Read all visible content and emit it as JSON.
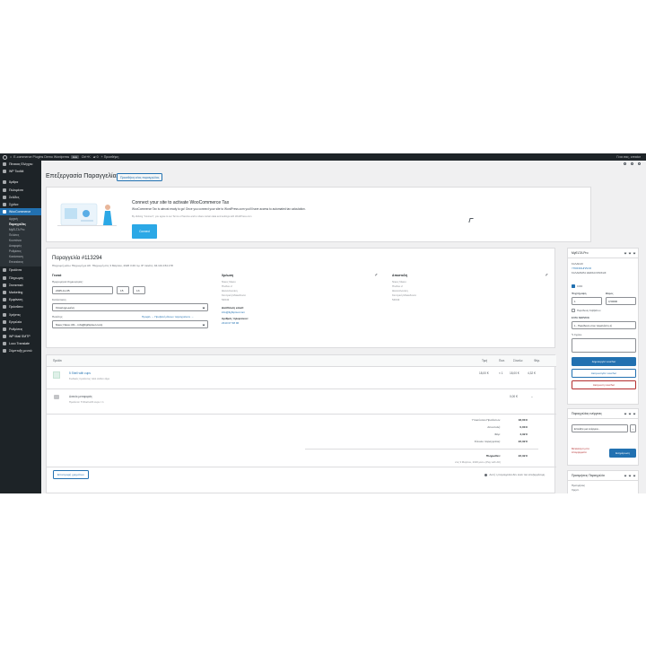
{
  "adminbar": {
    "site_name": "E-commerce Plugins Demo Wordpress",
    "site_badge": "Live",
    "comments_count": "Ctrl+K",
    "updates_count": "0",
    "new_label": "Προσθήκη",
    "greeting": "Γεια σας, creator"
  },
  "sidebar": {
    "items_top": [
      {
        "label": "Πίνακας Ελέγχου",
        "icon": "dashboard-icon"
      },
      {
        "label": "WP Toolkit",
        "icon": "toolkit-icon"
      }
    ],
    "items_mid": [
      {
        "label": "Άρθρα",
        "icon": "pin-icon"
      },
      {
        "label": "Πολυμέσα",
        "icon": "media-icon"
      },
      {
        "label": "Σελίδες",
        "icon": "page-icon"
      },
      {
        "label": "Σχόλια",
        "icon": "comment-icon"
      }
    ],
    "active": {
      "label": "WooCommerce",
      "icon": "woo-icon"
    },
    "submenu": [
      {
        "label": "Αρχική",
        "current": false
      },
      {
        "label": "Παραγγελίες",
        "current": true
      },
      {
        "label": "MyELTA Pro",
        "current": false
      },
      {
        "label": "Πελάτες",
        "current": false
      },
      {
        "label": "Κουπόνια",
        "current": false
      },
      {
        "label": "Αναφορές",
        "current": false
      },
      {
        "label": "Ρυθμίσεις",
        "current": false
      },
      {
        "label": "Κατάσταση",
        "current": false
      },
      {
        "label": "Επεκτάσεις",
        "current": false
      }
    ],
    "items_bottom": [
      {
        "label": "Προϊόντα",
        "icon": "products-icon"
      },
      {
        "label": "Πληρωμές",
        "icon": "payments-icon"
      },
      {
        "label": "Στατιστικά",
        "icon": "analytics-icon"
      },
      {
        "label": "Marketing",
        "icon": "marketing-icon"
      },
      {
        "label": "Εμφάνιση",
        "icon": "appearance-icon"
      },
      {
        "label": "Πρόσθετα",
        "icon": "plugins-icon"
      },
      {
        "label": "Χρήστες",
        "icon": "users-icon"
      },
      {
        "label": "Εργαλεία",
        "icon": "tools-icon"
      },
      {
        "label": "Ρυθμίσεις",
        "icon": "settings-icon"
      },
      {
        "label": "WP Mail SMTP",
        "icon": "mail-icon"
      },
      {
        "label": "Loco Translate",
        "icon": "translate-icon"
      },
      {
        "label": "Σύμπτυξη μενού",
        "icon": "collapse-icon"
      }
    ]
  },
  "header": {
    "title": "Επεξεργασία Παραγγελίας",
    "add_button": "Προσθήκη νέας παραγγελίας"
  },
  "notice": {
    "title": "Connect your site to activate WooCommerce Tax",
    "description": "WooCommerce Tax is almost ready to go! Once you connect your site to WordPress.com you'll have access to automated tax calculation.",
    "terms": "By clicking \"Connect\", you agree to our Terms of Service and to share certain data and settings with WordPress.com",
    "button": "Connect"
  },
  "order": {
    "title": "Παραγγελία #113294",
    "meta": "Πληρωμή μέσω Πληρωμή με ΑΚ: Πληρωμή στις 3 Μαρτίου, 2026 3:49 πμ. IP πελάτη: 94.131.154.178",
    "general_heading": "Γενικά",
    "date_label": "Ημερομηνία δημιουργίας:",
    "date_value": "2025-11-05",
    "hour_value": "15",
    "minute_value": "13",
    "status_label": "Κατάσταση:",
    "status_value": "Ολοκληρωμένη",
    "customer_label": "Πελάτης:",
    "customer_links": "Προφίλ → Προβολή άλλων παραγγελιών →",
    "customer_value": "Νίκος Νίκου (#1 - info@lightpixel.com)",
    "billing_heading": "Χρέωση",
    "billing_lines": [
      "Νίκος Νίκου",
      "Πίνδου 2",
      "Θεσσαλονίκη",
      "Κεντρική Μακεδονία",
      "54643"
    ],
    "email_label": "Διεύθυνση email:",
    "email_value": "info@lightpixel.com",
    "phone_label": "Αριθμός τηλεφώνου:",
    "phone_value": "2310 07 68 96",
    "shipping_heading": "Αποστολή",
    "shipping_lines": [
      "Νίκος Νίκου",
      "Πίνδου 2",
      "Θεσσαλονίκη",
      "Κεντρική Μακεδονία",
      "54643"
    ]
  },
  "items": {
    "headers": {
      "product": "Προϊόν",
      "cost": "Τιμή",
      "qty": "Ποσ.",
      "total": "Σύνολο",
      "tax": "Φόρ."
    },
    "product": {
      "name": "5 Shell with cups",
      "sku": "Κωδικός προϊόντος: Θελ ανθού λέρο",
      "cost": "18,00 €",
      "qty": "× 1",
      "total": "18,00 €",
      "tax": "4,32 €"
    },
    "fee": {
      "name": "Διανύκ μεταφοράς",
      "sub": "Προϊόντα: 5 Shell with cups × 1",
      "total": "0,00 €",
      "tax": "–"
    },
    "totals": [
      {
        "label": "Υποσύνολο Προϊόντων:",
        "value": "18,00 €"
      },
      {
        "label": "Αποστολή:",
        "value": "0,00 €"
      },
      {
        "label": "Φόρ:",
        "value": "4,32 €"
      },
      {
        "label": "Σύνολο παραγγελίας:",
        "value": "22,32 €"
      }
    ],
    "paid_label": "Πληρωθεν:",
    "paid_value": "22,32 €",
    "paid_note": "στις 3 Μαρτίου, 2026 μέσω (Pay with AK)",
    "refund_button": "Επιστροφή χρημάτων",
    "not_editable": "Αυτή η παραγγελία δεν είναι πια επεξεργάσιμη."
  },
  "myelta": {
    "title": "MyELTA Pro",
    "lines": [
      "ΚΑΛΑΚΑΣ",
      "ΥΠΟΣΚΚΗΠΛΙΟΣ",
      "ΚΑΛΑΜΑΡΙΑ ΘΕΣΣΑΛΟΝΙΚΗΣ"
    ],
    "cod_label": "COD",
    "pieces_label": "Ψυχιτήραψη",
    "weight_label": "Βάρος",
    "pieces_value": "1",
    "weight_value": "0,50000",
    "extra_label": "Παράδοση Σαββάτου",
    "service_label": "ΕΛΤΑ SERVICE",
    "service_value": "1 - Παράδοση στον παραλήπτη (ή",
    "notes_label": "Σχόλιο",
    "create_button": "Δημιουργία voucher",
    "print_button": "Ακύρωση/σε voucher",
    "cancel_button": "Ακύρωση voucher"
  },
  "actions": {
    "title": "Παραγγελίας ενέργειες",
    "select_value": "Επιλέξτε μια ενέργεια...",
    "move_link": "Μετακίνηση στα",
    "trash_link": "Απορρίμματα",
    "update_button": "Ενημέρωση"
  },
  "preferences": {
    "title": "Προτιμήσεις Παραγγελία",
    "line1": "Προτιμήσεις",
    "line2": "Χρηστ."
  }
}
